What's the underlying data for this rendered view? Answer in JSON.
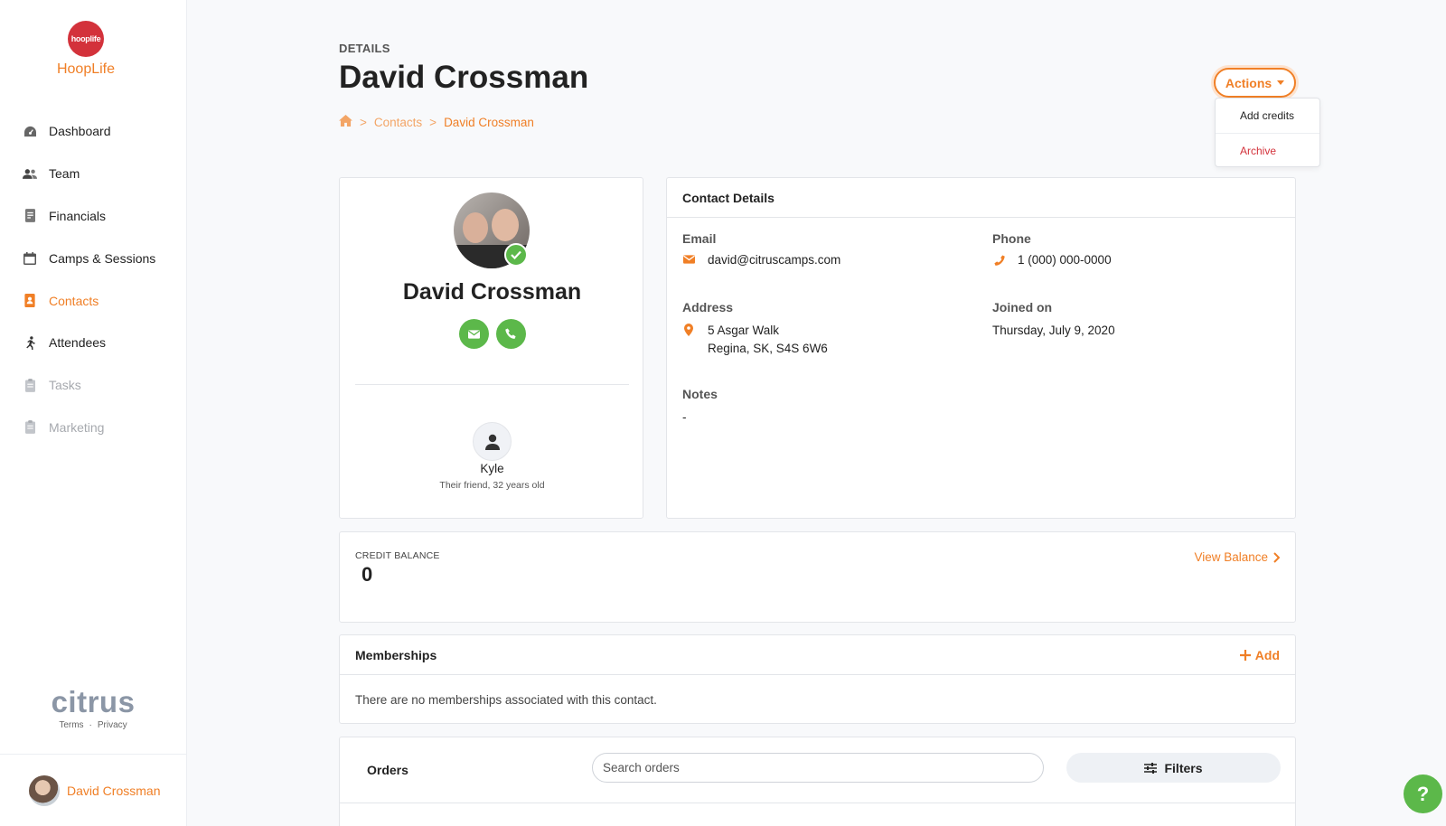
{
  "brand": {
    "logo_text": "hooplife",
    "name": "HoopLife"
  },
  "nav": {
    "items": [
      {
        "label": "Dashboard",
        "icon": "dashboard-icon"
      },
      {
        "label": "Team",
        "icon": "team-icon"
      },
      {
        "label": "Financials",
        "icon": "financials-icon"
      },
      {
        "label": "Camps & Sessions",
        "icon": "calendar-icon"
      },
      {
        "label": "Contacts",
        "icon": "contacts-icon",
        "active": true
      },
      {
        "label": "Attendees",
        "icon": "runner-icon"
      },
      {
        "label": "Tasks",
        "icon": "clipboard-icon",
        "disabled": true
      },
      {
        "label": "Marketing",
        "icon": "clipboard-icon",
        "disabled": true
      }
    ]
  },
  "footer": {
    "logo": "citrus",
    "terms": "Terms",
    "separator": "·",
    "privacy": "Privacy"
  },
  "user": {
    "name": "David Crossman"
  },
  "header": {
    "eyebrow": "DETAILS",
    "title": "David Crossman",
    "breadcrumb": {
      "sep": ">",
      "contacts": "Contacts",
      "current": "David Crossman"
    },
    "actions_label": "Actions",
    "actions_menu": [
      "Add credits",
      "Archive"
    ]
  },
  "profile": {
    "name": "David Crossman",
    "relation": {
      "name": "Kyle",
      "description": "Their friend, 32 years old"
    }
  },
  "contact_details": {
    "title": "Contact Details",
    "email_label": "Email",
    "email": "david@citruscamps.com",
    "phone_label": "Phone",
    "phone": "1 (000) 000-0000",
    "address_label": "Address",
    "address_line1": "5 Asgar Walk",
    "address_line2": "Regina, SK, S4S 6W6",
    "joined_label": "Joined on",
    "joined": "Thursday, July 9, 2020",
    "notes_label": "Notes",
    "notes": "-"
  },
  "credit": {
    "label": "CREDIT BALANCE",
    "value": "0",
    "view_label": "View Balance"
  },
  "memberships": {
    "title": "Memberships",
    "add_label": "Add",
    "empty": "There are no memberships associated with this contact."
  },
  "orders": {
    "title": "Orders",
    "search_placeholder": "Search orders",
    "filters_label": "Filters"
  },
  "help": {
    "label": "?"
  },
  "colors": {
    "accent": "#f07f26",
    "success": "#5cb84a",
    "danger": "#d3323b"
  }
}
